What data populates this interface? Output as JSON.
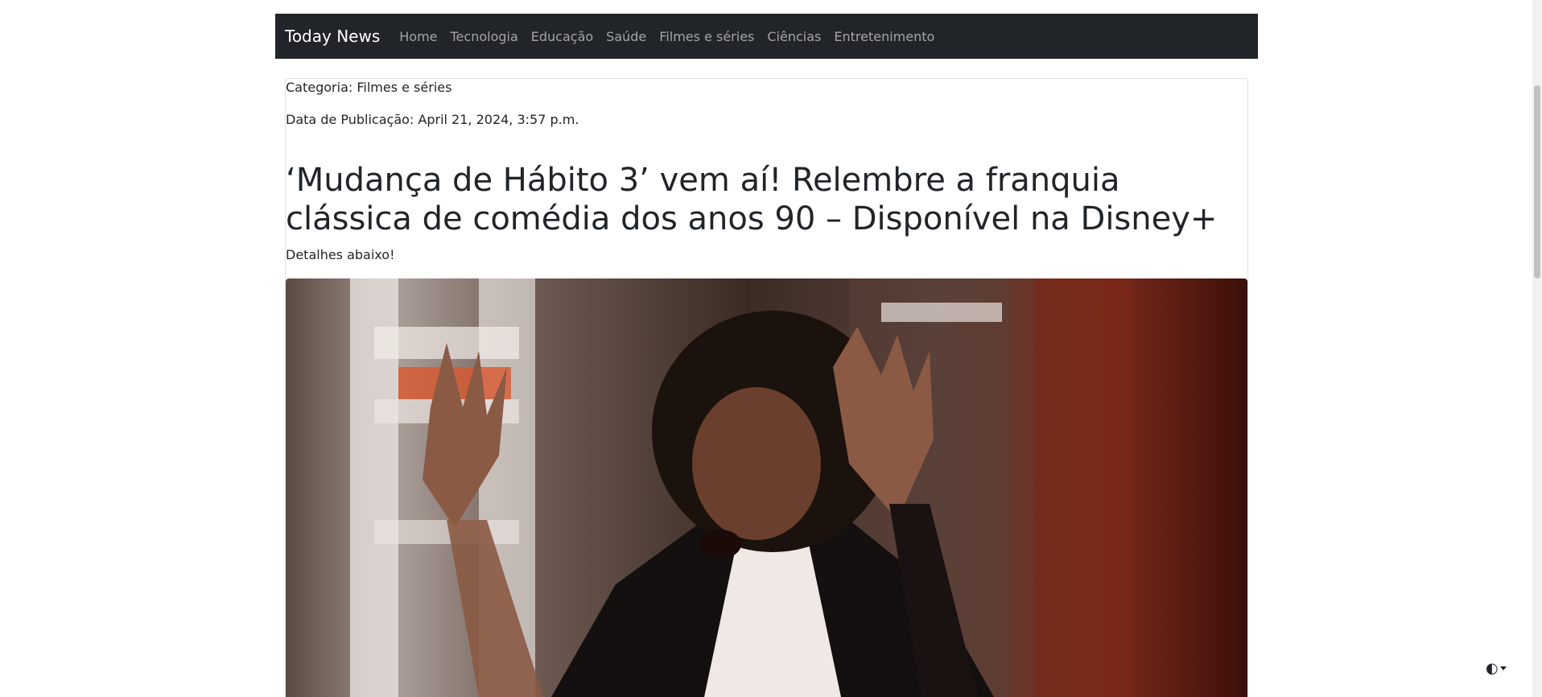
{
  "navbar": {
    "brand": "Today News",
    "links": [
      "Home",
      "Tecnologia",
      "Educação",
      "Saúde",
      "Filmes e séries",
      "Ciências",
      "Entretenimento"
    ]
  },
  "article": {
    "category": "Categoria: Filmes e séries",
    "published": "Data de Publicação: April 21, 2024, 3:57 p.m.",
    "title": "‘Mudança de Hábito 3’ vem aí! Relembre a franquia clássica de comédia dos anos 90 – Disponível na Disney+",
    "subtitle": "Detalhes abaixo!"
  },
  "icons": {
    "theme_toggle": "half-circle-contrast-icon"
  },
  "colors": {
    "navbar_bg": "#212529",
    "nav_link": "rgba(255,255,255,0.58)",
    "brand": "#ffffff"
  }
}
